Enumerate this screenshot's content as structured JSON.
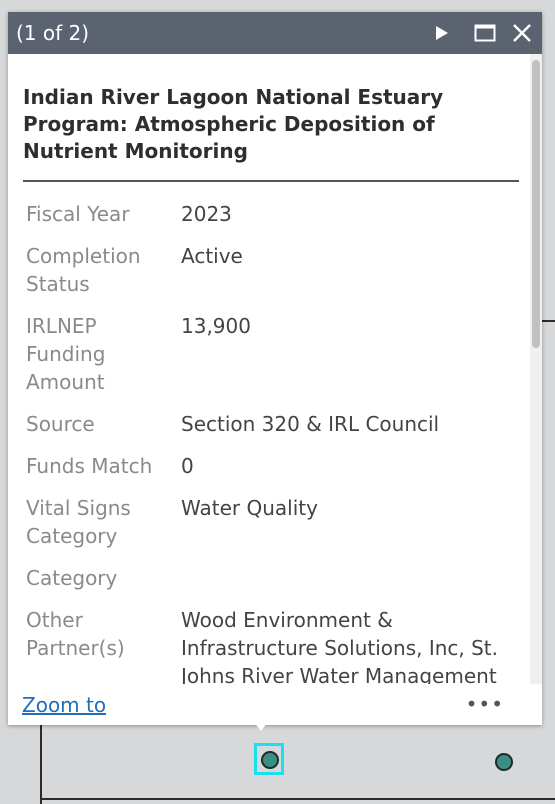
{
  "popup": {
    "counter": "(1 of 2)",
    "title": "Indian River Lagoon National Estuary Program: Atmospheric Deposition of Nutrient Monitoring",
    "fields": [
      {
        "label": "Fiscal Year",
        "value": "2023"
      },
      {
        "label": "Completion Status",
        "value": "Active"
      },
      {
        "label": "IRLNEP Funding Amount",
        "value": "13,900"
      },
      {
        "label": "Source",
        "value": "Section 320 & IRL Council"
      },
      {
        "label": "Funds Match",
        "value": "0"
      },
      {
        "label": "Vital Signs Category",
        "value": "Water Quality"
      },
      {
        "label": "Category",
        "value": ""
      },
      {
        "label": "Other Partner(s)",
        "value": "Wood Environment & Infrastructure Solutions, Inc, St. Johns River Water Management District, Indian"
      }
    ],
    "zoom_label": "Zoom to",
    "more_label": "•••"
  },
  "icons": {
    "next": "play-icon",
    "maximize": "maximize-icon",
    "close": "close-icon"
  },
  "colors": {
    "header": "#5b6270",
    "selection": "#17e0ef",
    "point": "#3b8e86",
    "link": "#1f6fb8"
  }
}
